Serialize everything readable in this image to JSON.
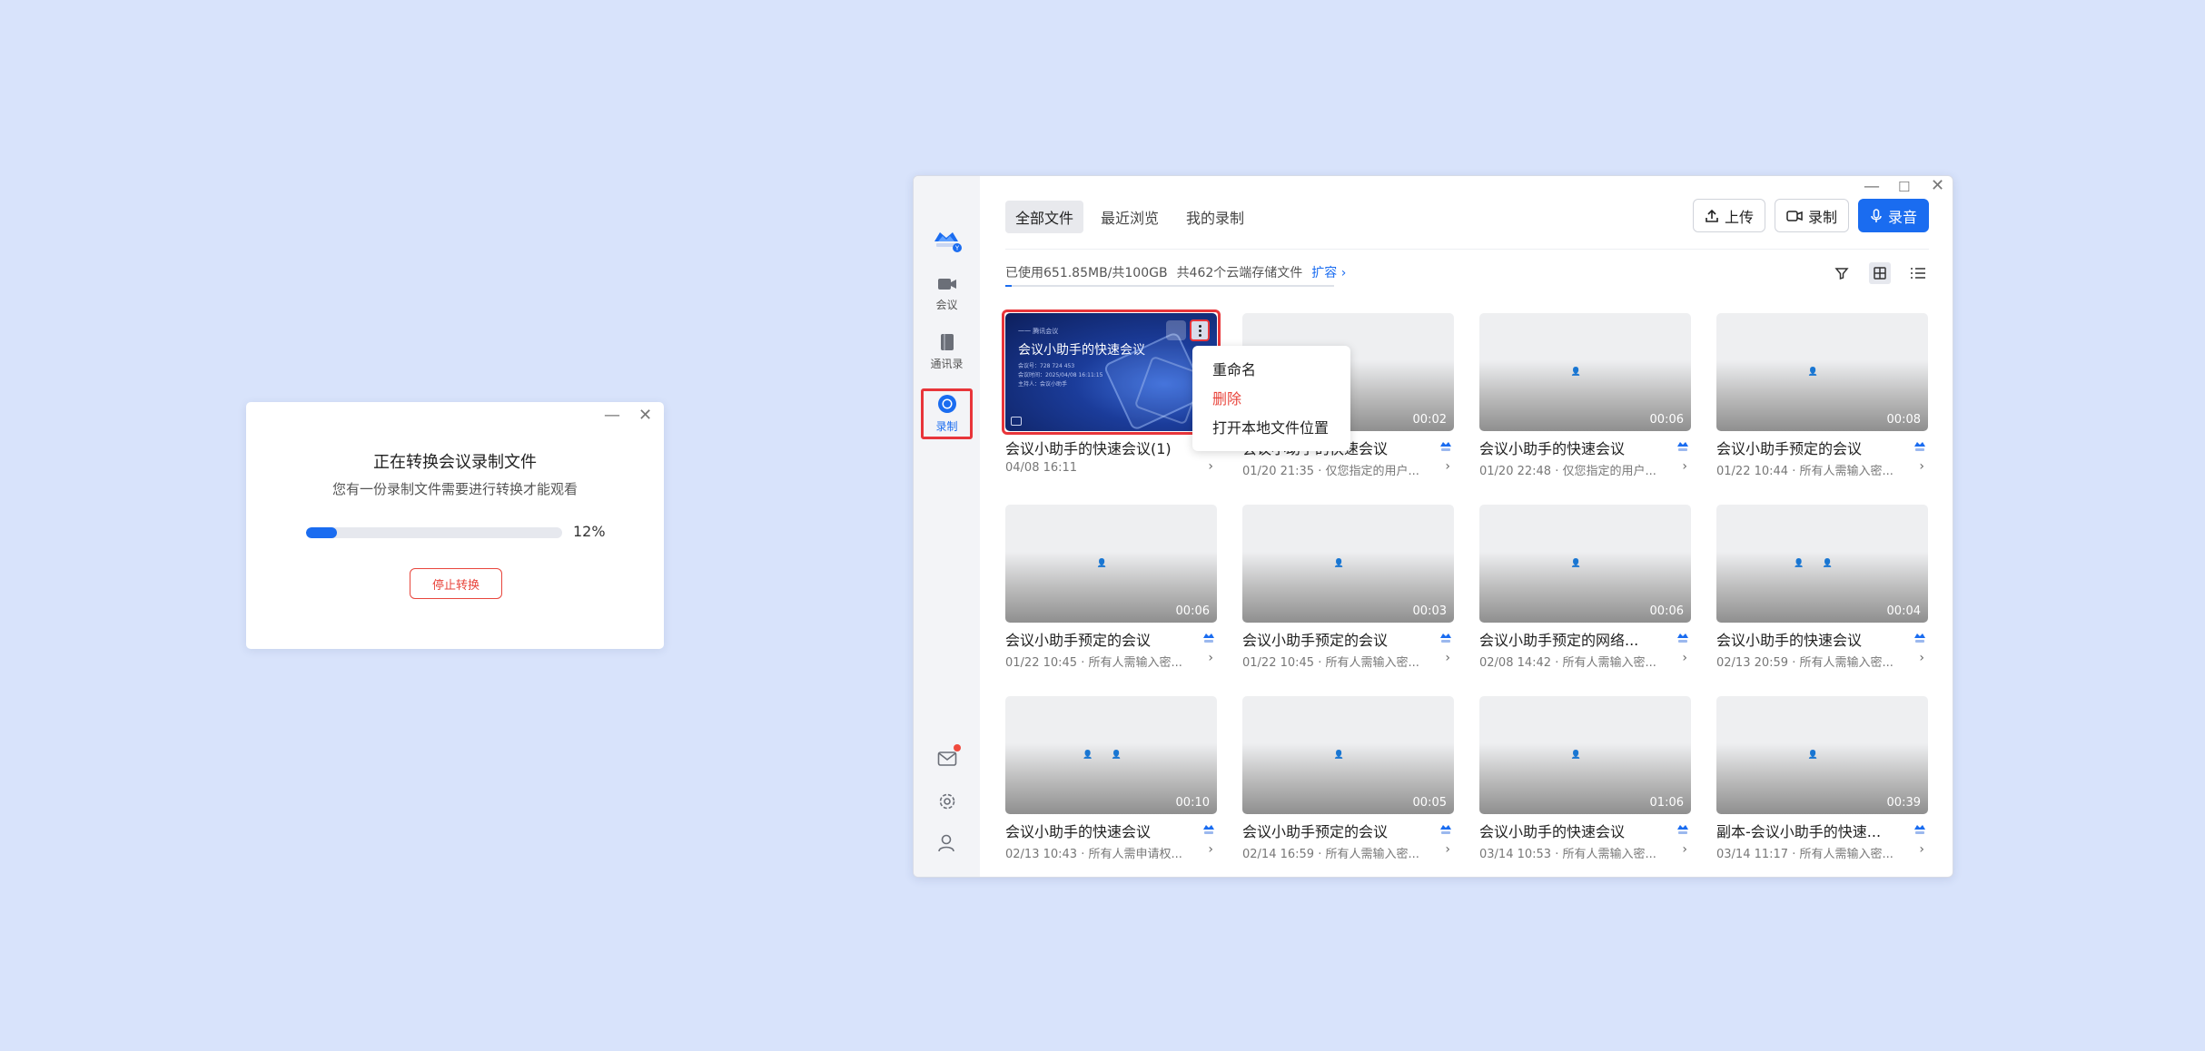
{
  "dialog": {
    "title": "正在转换会议录制文件",
    "subtitle": "您有一份录制文件需要进行转换才能观看",
    "progress": 0.12,
    "progress_label": "12%",
    "stop_label": "停止转换",
    "min_glyph": "—",
    "close_glyph": "✕"
  },
  "window": {
    "min_glyph": "—",
    "max_glyph": "☐",
    "close_glyph": "✕"
  },
  "sidebar": {
    "items": [
      {
        "label": "会议",
        "icon": "video-camera-icon"
      },
      {
        "label": "通讯录",
        "icon": "address-book-icon"
      },
      {
        "label": "录制",
        "icon": "record-icon",
        "active": true
      }
    ],
    "bottom": [
      "mail-icon",
      "gear-icon",
      "user-settings-icon"
    ]
  },
  "tabs": [
    "全部文件",
    "最近浏览",
    "我的录制"
  ],
  "buttons": {
    "upload": "上传",
    "record": "录制",
    "audio": "录音"
  },
  "usage": {
    "used": "已使用651.85MB/共100GB",
    "count": "共462个云端存储文件",
    "expand": "扩容 ›"
  },
  "context_menu": {
    "rename": "重命名",
    "delete": "删除",
    "open_local": "打开本地文件位置"
  },
  "featured": {
    "small": "一一 腾讯会议",
    "title": "会议小助手的快速会议",
    "lines": [
      "会议号：728 724 453",
      "会议时间：2025/04/08 16:11:15",
      "主持人：会议小助手"
    ],
    "duration": "04"
  },
  "colors": {
    "accent": "#1a6cf0",
    "danger": "#e8453c",
    "background": "#d8e3fb"
  },
  "files": [
    {
      "title": "会议小助手的快速会议(1)",
      "sub": "04/08 16:11",
      "duration": "04",
      "featured": true,
      "badge": false
    },
    {
      "title": "会议小助手的快速会议",
      "sub": "01/20 21:35 · 仅您指定的用户...",
      "duration": "00:02",
      "badge": true,
      "persons": "👤"
    },
    {
      "title": "会议小助手的快速会议",
      "sub": "01/20 22:48 · 仅您指定的用户...",
      "duration": "00:06",
      "badge": true,
      "persons": "👤"
    },
    {
      "title": "会议小助手预定的会议",
      "sub": "01/22 10:44 · 所有人需输入密...",
      "duration": "00:08",
      "badge": true,
      "persons": "👤"
    },
    {
      "title": "会议小助手预定的会议",
      "sub": "01/22 10:45 · 所有人需输入密...",
      "duration": "00:06",
      "badge": true,
      "persons": "👤"
    },
    {
      "title": "会议小助手预定的会议",
      "sub": "01/22 10:45 · 所有人需输入密...",
      "duration": "00:03",
      "badge": true,
      "persons": "👤"
    },
    {
      "title": "会议小助手预定的网络...",
      "sub": "02/08 14:42 · 所有人需输入密...",
      "duration": "00:06",
      "badge": true,
      "persons": "👤"
    },
    {
      "title": "会议小助手的快速会议",
      "sub": "02/13 20:59 · 所有人需输入密...",
      "duration": "00:04",
      "badge": true,
      "persons": "👤👤"
    },
    {
      "title": "会议小助手的快速会议",
      "sub": "02/13 10:43 · 所有人需申请权...",
      "duration": "00:10",
      "badge": true,
      "persons": "👤👤"
    },
    {
      "title": "会议小助手预定的会议",
      "sub": "02/14 16:59 · 所有人需输入密...",
      "duration": "00:05",
      "badge": true,
      "persons": "👤"
    },
    {
      "title": "会议小助手的快速会议",
      "sub": "03/14 10:53 · 所有人需输入密...",
      "duration": "01:06",
      "badge": true,
      "persons": "👤"
    },
    {
      "title": "副本-会议小助手的快速...",
      "sub": "03/14 11:17 · 所有人需输入密...",
      "duration": "00:39",
      "badge": true,
      "persons": "👤"
    }
  ]
}
